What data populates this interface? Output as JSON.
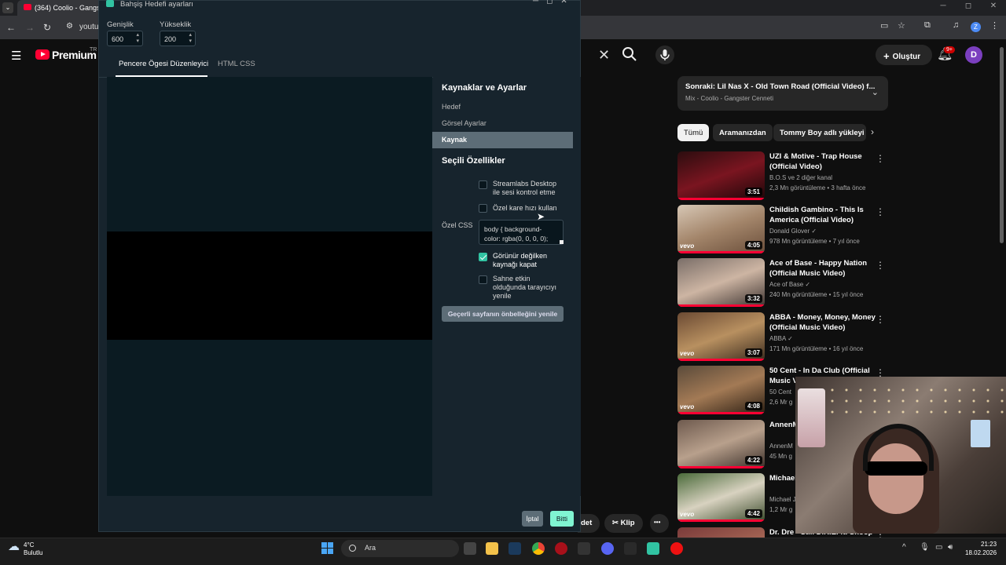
{
  "browser": {
    "tab_title": "(364) Coolio - Gangste",
    "url": "youtu",
    "tab_menu_icon": "chevron-down-icon",
    "window_controls": [
      "─",
      "◻",
      "✕"
    ],
    "profile_initial": "Z"
  },
  "youtube": {
    "premium_label": "Premium",
    "region": "TR",
    "create_label": "Oluştur",
    "notification_count": "9+",
    "avatar_initial": "D",
    "playlist": {
      "title": "Sonraki: Lil Nas X - Old Town Road (Official Video) f...",
      "subtitle": "Mix - Coolio - Gangster Cenneti"
    },
    "chips": [
      "Tümü",
      "Aramanızdan",
      "Tommy Boy adlı yükleyi"
    ],
    "videos": [
      {
        "title": "UZI & Motive - Trap House (Official Video)",
        "channel": "B.O.S ve 2 diğer kanal",
        "meta": "2,3 Mn görüntüleme • 3 hafta önce",
        "duration": "3:51"
      },
      {
        "title": "Childish Gambino - This Is America (Official Video)",
        "channel": "Donald Glover ✓",
        "meta": "978 Mn görüntüleme • 7 yıl önce",
        "duration": "4:05"
      },
      {
        "title": "Ace of Base - Happy Nation (Official Music Video)",
        "channel": "Ace of Base ✓",
        "meta": "240 Mn görüntüleme • 15 yıl önce",
        "duration": "3:32"
      },
      {
        "title": "ABBA - Money, Money, Money (Official Music Video)",
        "channel": "ABBA ✓",
        "meta": "171 Mn görüntüleme • 16 yıl önce",
        "duration": "3:07"
      },
      {
        "title": "50 Cent - In Da Club (Official Music V",
        "channel": "50 Cent",
        "meta": "2,6 Mr g",
        "duration": "4:08"
      },
      {
        "title": "AnnenM Hurra di",
        "channel": "AnnenM",
        "meta": "45 Mn g",
        "duration": "4:22"
      },
      {
        "title": "Michael Care Ab",
        "channel": "Michael J",
        "meta": "1,2 Mr g",
        "duration": "4:42"
      },
      {
        "title": "Dr. Dre - Still D.R.E. ft. Snoop",
        "channel": "",
        "meta": "",
        "duration": ""
      }
    ],
    "bottom_buttons": {
      "save_partial": "det",
      "clip": "Klip",
      "more": "•••"
    }
  },
  "dialog": {
    "title": "Bahşiş Hedefi ayarları",
    "width_label": "Genişlik",
    "width_value": "600",
    "height_label": "Yükseklik",
    "height_value": "200",
    "tabs": [
      "Pencere Ögesi Düzenleyici",
      "HTML CSS"
    ],
    "side_heading": "Kaynaklar ve Ayarlar",
    "side_items": [
      "Hedef",
      "Görsel Ayarlar",
      "Kaynak"
    ],
    "selected_heading": "Seçili Özellikler",
    "checkboxes": [
      {
        "label": "Streamlabs Desktop ile sesi kontrol etme",
        "checked": false
      },
      {
        "label": "Özel kare hızı kullan",
        "checked": false
      },
      {
        "label": "Görünür değilken kaynağı kapat",
        "checked": true
      },
      {
        "label": "Sahne etkin olduğunda tarayıcıyı yenile",
        "checked": false
      }
    ],
    "custom_css_label": "Özel CSS",
    "custom_css_value": "body { background-color: rgba(0, 0, 0, 0);",
    "refresh_button": "Geçerli sayfanın önbelleğini yenile",
    "cancel_button": "İptal",
    "done_button": "Bitti"
  },
  "taskbar": {
    "weather_temp": "4°C",
    "weather_desc": "Bulutlu",
    "search_placeholder": "Ara",
    "time": "21:23",
    "date": "18.02.2026"
  },
  "colors": {
    "accent": "#31c3a2",
    "done": "#80f5d2",
    "youtube_red": "#ff0033",
    "dialog_bg": "#17242d"
  }
}
